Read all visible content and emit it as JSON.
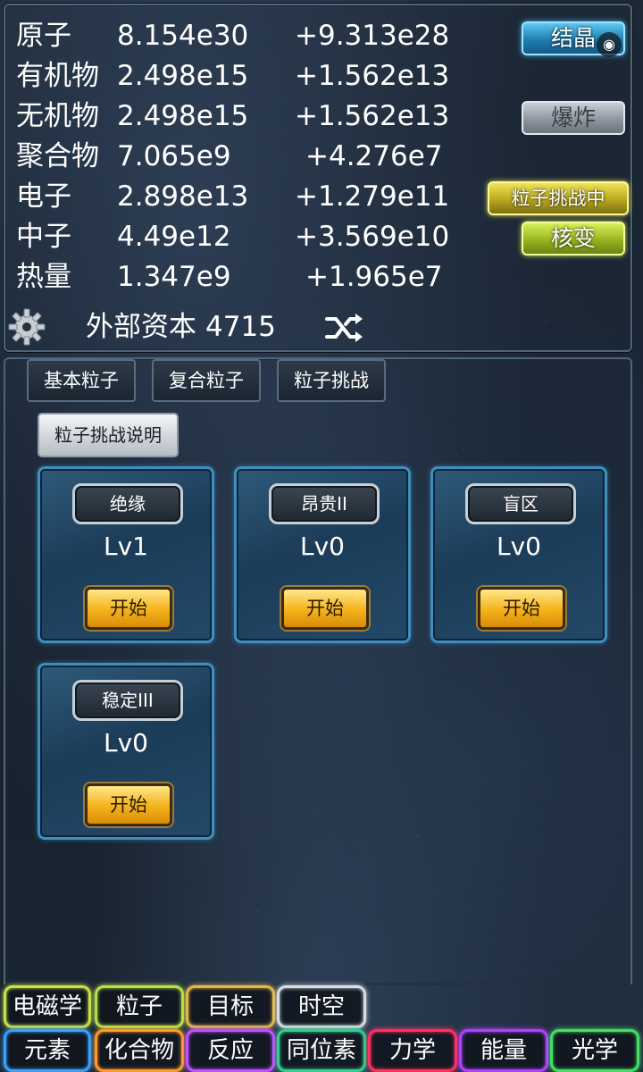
{
  "stats": [
    {
      "name": "原子",
      "value": "8.154e30",
      "rate": "+9.313e28"
    },
    {
      "name": "有机物",
      "value": "2.498e15",
      "rate": "+1.562e13"
    },
    {
      "name": "无机物",
      "value": "2.498e15",
      "rate": "+1.562e13"
    },
    {
      "name": "聚合物",
      "value": "7.065e9",
      "rate": "+4.276e7"
    },
    {
      "name": "电子",
      "value": "2.898e13",
      "rate": "+1.279e11"
    },
    {
      "name": "中子",
      "value": "4.49e12",
      "rate": "+3.569e10"
    },
    {
      "name": "热量",
      "value": "1.347e9",
      "rate": "+1.965e7"
    }
  ],
  "side_buttons": {
    "crystal": "结晶",
    "explode": "爆炸",
    "challenge": "粒子挑战中",
    "fission": "核变"
  },
  "record_icon": "◉",
  "capital": {
    "label": "外部资本",
    "value": "4715"
  },
  "icons": {
    "settings": "gear-icon",
    "shuffle": "shuffle-icon"
  },
  "tabs": [
    "基本粒子",
    "复合粒子",
    "粒子挑战"
  ],
  "help_button": "粒子挑战说明",
  "challenges": [
    {
      "name": "绝缘",
      "level": "Lv1",
      "start": "开始"
    },
    {
      "name": "昂贵II",
      "level": "Lv0",
      "start": "开始"
    },
    {
      "name": "盲区",
      "level": "Lv0",
      "start": "开始"
    },
    {
      "name": "稳定III",
      "level": "Lv0",
      "start": "开始"
    }
  ],
  "nav_row1": [
    {
      "label": "电磁学",
      "color": "#c8e04a"
    },
    {
      "label": "粒子",
      "color": "#b6e04a"
    },
    {
      "label": "目标",
      "color": "#e0b84a"
    },
    {
      "label": "时空",
      "color": "#d8dde3"
    }
  ],
  "nav_row2": [
    {
      "label": "元素",
      "color": "#3aa0ff"
    },
    {
      "label": "化合物",
      "color": "#ff9a2a"
    },
    {
      "label": "反应",
      "color": "#c050ff"
    },
    {
      "label": "同位素",
      "color": "#30d090"
    },
    {
      "label": "力学",
      "color": "#ff3060"
    },
    {
      "label": "能量",
      "color": "#b040ff"
    },
    {
      "label": "光学",
      "color": "#40e060"
    }
  ]
}
